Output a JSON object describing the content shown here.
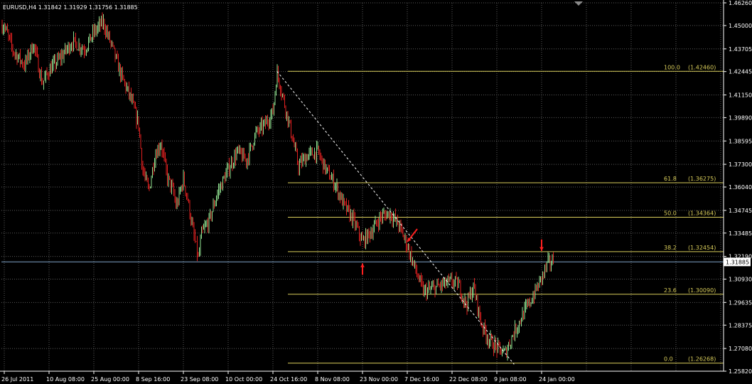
{
  "header": {
    "symbol_line": "EURUSD,H4  1.31842 1.31929 1.31756 1.31885"
  },
  "colors": {
    "background": "#000000",
    "grid": "#5a5a5a",
    "bull_candle": "#8fe08f",
    "bear_candle": "#e02020",
    "fib_line": "#d8cc5a",
    "trend_line": "#ffffff",
    "current_price_line": "#7fa3c8",
    "arrow": "#ff2020"
  },
  "price_axis": {
    "labels": [
      "1.46260",
      "1.45000",
      "1.43705",
      "1.42445",
      "1.41150",
      "1.39890",
      "1.38595",
      "1.37300",
      "1.36040",
      "1.34745",
      "1.33485",
      "1.32190",
      "1.30930",
      "1.29635",
      "1.28375",
      "1.27080",
      "1.25820"
    ],
    "current_price": "1.31885"
  },
  "time_axis": {
    "labels": [
      "26 Jul 2011",
      "10 Aug 08:00",
      "25 Aug 00:00",
      "8 Sep 16:00",
      "23 Sep 08:00",
      "10 Oct 00:00",
      "24 Oct 16:00",
      "8 Nov 08:00",
      "23 Nov 00:00",
      "7 Dec 16:00",
      "22 Dec 08:00",
      "9 Jan 08:00",
      "24 Jan 00:00"
    ]
  },
  "chart_data": {
    "type": "candlestick",
    "title": "EURUSD,H4",
    "ohlc": {
      "open": 1.31842,
      "high": 1.31929,
      "low": 1.31756,
      "close": 1.31885
    },
    "ylim": [
      1.2582,
      1.4626
    ],
    "x_ticks": [
      "26 Jul 2011",
      "10 Aug 08:00",
      "25 Aug 00:00",
      "8 Sep 16:00",
      "23 Sep 08:00",
      "10 Oct 00:00",
      "24 Oct 16:00",
      "8 Nov 08:00",
      "23 Nov 00:00",
      "7 Dec 16:00",
      "22 Dec 08:00",
      "9 Jan 08:00",
      "24 Jan 00:00"
    ],
    "price_path": [
      [
        "26 Jul 2011",
        1.45
      ],
      [
        "29 Jul 2011",
        1.436
      ],
      [
        "2 Aug 2011",
        1.428
      ],
      [
        "5 Aug 2011",
        1.44
      ],
      [
        "8 Aug 2011",
        1.418
      ],
      [
        "10 Aug 08:00",
        1.425
      ],
      [
        "14 Aug 2011",
        1.432
      ],
      [
        "18 Aug 2011",
        1.441
      ],
      [
        "22 Aug 2011",
        1.437
      ],
      [
        "25 Aug 00:00",
        1.446
      ],
      [
        "28 Aug 2011",
        1.452
      ],
      [
        "31 Aug 2011",
        1.438
      ],
      [
        "3 Sep 2011",
        1.422
      ],
      [
        "6 Sep 2011",
        1.41
      ],
      [
        "8 Sep 16:00",
        1.395
      ],
      [
        "10 Sep 2011",
        1.37
      ],
      [
        "12 Sep 2011",
        1.358
      ],
      [
        "14 Sep 2011",
        1.378
      ],
      [
        "16 Sep 2011",
        1.385
      ],
      [
        "18 Sep 2011",
        1.366
      ],
      [
        "20 Sep 2011",
        1.358
      ],
      [
        "21 Sep 2011",
        1.349
      ],
      [
        "23 Sep 08:00",
        1.365
      ],
      [
        "25 Sep 2011",
        1.353
      ],
      [
        "27 Sep 2011",
        1.335
      ],
      [
        "29 Sep 2011",
        1.32
      ],
      [
        "30 Sep 2011",
        1.334
      ],
      [
        "3 Oct 2011",
        1.342
      ],
      [
        "6 Oct 2011",
        1.357
      ],
      [
        "10 Oct 00:00",
        1.37
      ],
      [
        "13 Oct 2011",
        1.38
      ],
      [
        "16 Oct 2011",
        1.375
      ],
      [
        "19 Oct 2011",
        1.39
      ],
      [
        "22 Oct 2011",
        1.395
      ],
      [
        "24 Oct 16:00",
        1.402
      ],
      [
        "26 Oct 2011",
        1.424
      ],
      [
        "28 Oct 2011",
        1.41
      ],
      [
        "31 Oct 2011",
        1.388
      ],
      [
        "2 Nov 2011",
        1.372
      ],
      [
        "5 Nov 2011",
        1.378
      ],
      [
        "8 Nov 08:00",
        1.38
      ],
      [
        "11 Nov 2011",
        1.37
      ],
      [
        "14 Nov 2011",
        1.362
      ],
      [
        "17 Nov 2011",
        1.35
      ],
      [
        "20 Nov 2011",
        1.342
      ],
      [
        "23 Nov 00:00",
        1.33
      ],
      [
        "26 Nov 2011",
        1.336
      ],
      [
        "29 Nov 2011",
        1.344
      ],
      [
        "2 Dec 2011",
        1.346
      ],
      [
        "5 Dec 2011",
        1.339
      ],
      [
        "7 Dec 16:00",
        1.328
      ],
      [
        "10 Dec 2011",
        1.316
      ],
      [
        "13 Dec 2011",
        1.302
      ],
      [
        "16 Dec 2011",
        1.304
      ],
      [
        "19 Dec 2011",
        1.306
      ],
      [
        "22 Dec 08:00",
        1.308
      ],
      [
        "25 Dec 2011",
        1.306
      ],
      [
        "28 Dec 2011",
        1.295
      ],
      [
        "31 Dec 2011",
        1.305
      ],
      [
        "3 Jan 2012",
        1.285
      ],
      [
        "6 Jan 2012",
        1.276
      ],
      [
        "9 Jan 08:00",
        1.271
      ],
      [
        "12 Jan 2012",
        1.268
      ],
      [
        "15 Jan 2012",
        1.28
      ],
      [
        "18 Jan 2012",
        1.29
      ],
      [
        "21 Jan 2012",
        1.299
      ],
      [
        "24 Jan 00:00",
        1.31
      ],
      [
        "26 Jan 2012",
        1.318
      ],
      [
        "28 Jan 2012",
        1.31885
      ]
    ],
    "fibonacci": {
      "levels": [
        {
          "label": "100.0",
          "value": "(1.42460)",
          "price": 1.4246
        },
        {
          "label": "61.8",
          "value": "(1.36275)",
          "price": 1.36275
        },
        {
          "label": "50.0",
          "value": "(1.34364)",
          "price": 1.34364
        },
        {
          "label": "38.2",
          "value": "(1.32454)",
          "price": 1.32454
        },
        {
          "label": "23.6",
          "value": "(1.30090)",
          "price": 1.3009
        },
        {
          "label": "0.0",
          "value": "(1.26268)",
          "price": 1.26268
        }
      ]
    },
    "trend_line": {
      "from": [
        "26 Oct 2011",
        1.4246
      ],
      "to": [
        "15 Jan 2012",
        1.262
      ]
    },
    "arrows": [
      {
        "direction": "up",
        "at": [
          "23 Nov 00:00",
          1.318
        ]
      },
      {
        "direction": "down-left",
        "at": [
          "7 Dec 16:00",
          1.33
        ]
      },
      {
        "direction": "down",
        "at": [
          "24 Jan 00:00",
          1.325
        ]
      }
    ],
    "grid": true
  }
}
